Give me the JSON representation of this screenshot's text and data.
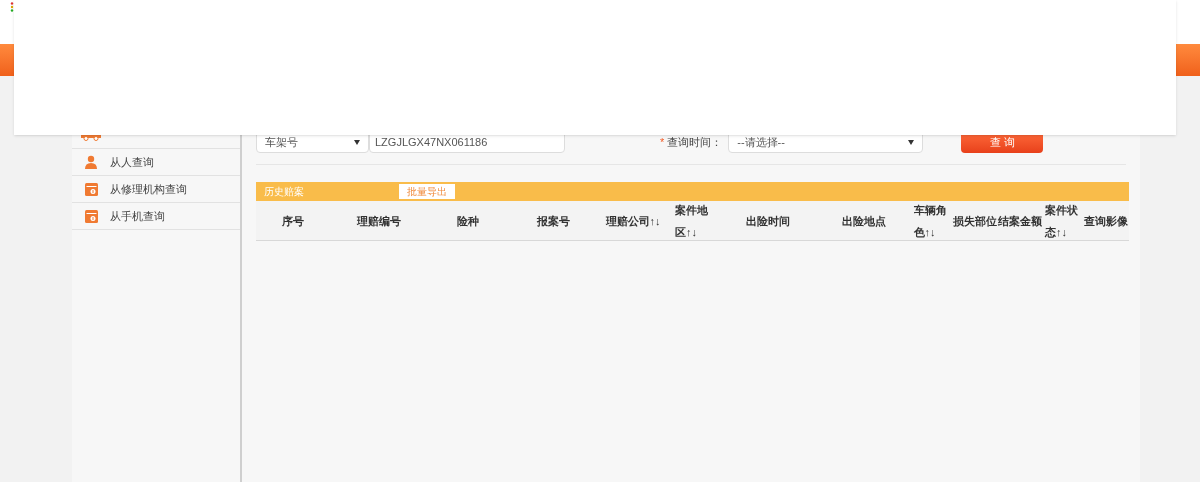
{
  "sidebar": {
    "items": [
      {
        "kind": "car"
      },
      {
        "label": "从人查询",
        "kind": "person"
      },
      {
        "label": "从修理机构查询",
        "kind": "card"
      },
      {
        "label": "从手机查询",
        "kind": "card"
      }
    ]
  },
  "search": {
    "type_select": "车架号",
    "vin_value": "LZGJLGX47NX061186",
    "required_mark": "*",
    "time_label": "查询时间：",
    "time_placeholder": "--请选择--",
    "button": "查 询"
  },
  "history": {
    "title": "历史赔案",
    "export_button": "批量导出",
    "columns": [
      "序号",
      "理赔编号",
      "险种",
      "报案号",
      "理赔公司↑↓",
      "案件地区↑↓",
      "出险时间",
      "出险地点",
      "车辆角色↑↓",
      "损失部位",
      "结案金额",
      "案件状态↑↓",
      "查询影像"
    ]
  }
}
